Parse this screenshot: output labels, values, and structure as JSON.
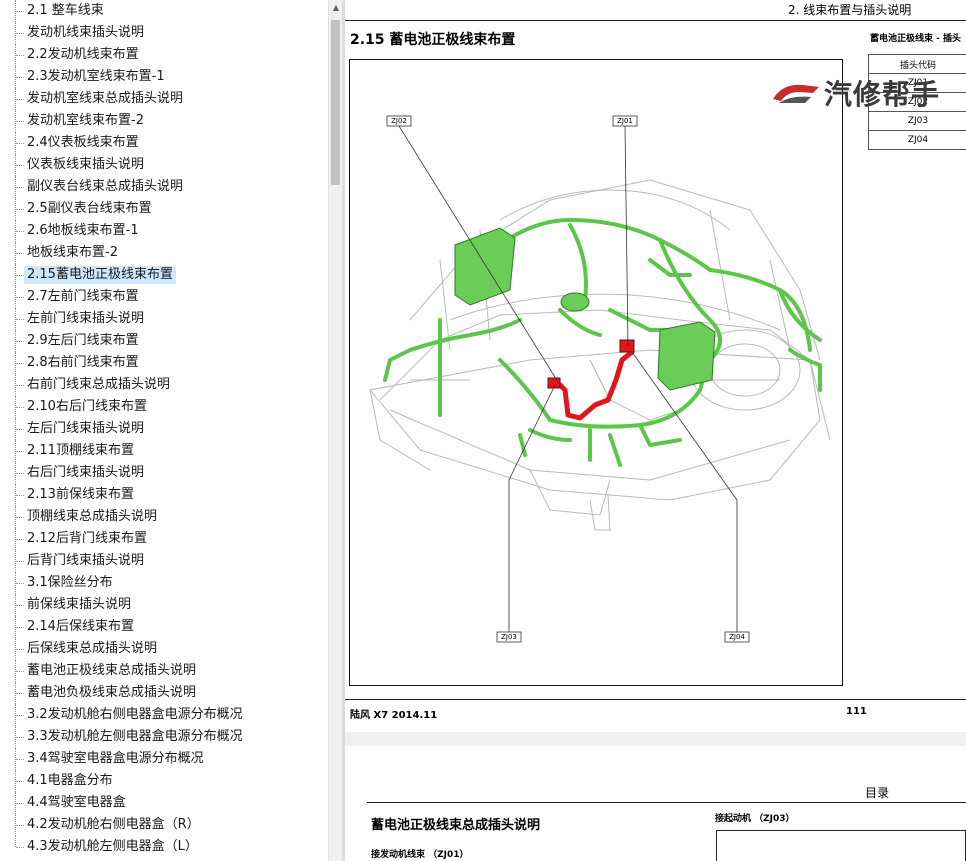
{
  "bookmarks": {
    "items": [
      "2.1 整车线束",
      "发动机线束插头说明",
      "2.2发动机线束布置",
      "2.3发动机室线束布置-1",
      "发动机室线束总成插头说明",
      "发动机室线束布置-2",
      "2.4仪表板线束布置",
      "仪表板线束插头说明",
      "副仪表台线束总成插头说明",
      "2.5副仪表台线束布置",
      "2.6地板线束布置-1",
      "地板线束布置-2",
      "2.15蓄电池正极线束布置",
      "2.7左前门线束布置",
      "左前门线束插头说明",
      "2.9左后门线束布置",
      "2.8右前门线束布置",
      "右前门线束总成插头说明",
      "2.10右后门线束布置",
      "左后门线束插头说明",
      "2.11顶棚线束布置",
      "右后门线束插头说明",
      "2.13前保线束布置",
      "顶棚线束总成插头说明",
      "2.12后背门线束布置",
      "后背门线束插头说明",
      "3.1保险丝分布",
      "前保线束插头说明",
      "2.14后保线束布置",
      "后保线束总成插头说明",
      "蓄电池正极线束总成插头说明",
      "蓄电池负极线束总成插头说明",
      "3.2发动机舱右侧电器盒电源分布概况",
      "3.3发动机舱左侧电器盒电源分布概况",
      "3.4驾驶室电器盒电源分布概况",
      "4.1电器盒分布",
      "4.4驾驶室电器盒",
      "4.2发动机舱右侧电器盒（R）",
      "4.3发动机舱左侧电器盒（L）"
    ],
    "selected_index": 12
  },
  "scrollbar": {
    "up_arrow": "▲"
  },
  "page1": {
    "header_right": "2. 线束布置与插头说明",
    "section_title": "2.15 蓄电池正极线束布置",
    "side_caption": "蓄电池正极线束 - 插头",
    "table_header": "插头代码",
    "table_rows": [
      "ZJ01",
      "ZJ02",
      "ZJ03",
      "ZJ04"
    ],
    "figure_labels": {
      "zj02": "ZJ02",
      "zj01": "ZJ01",
      "zj03": "ZJ03",
      "zj04": "ZJ04"
    },
    "footer_left": "陆风 X7 2014.11",
    "footer_right": "111"
  },
  "page2": {
    "contents_label": "目录",
    "title": "蓄电池正极线束总成插头说明",
    "subtitle": "接发动机线束 （ZJ01）",
    "right_text": "接起动机 （ZJ03）"
  },
  "watermark": {
    "text": "汽修帮手"
  },
  "colors": {
    "harness_green": "#5cc64a",
    "battery_red": "#e0161b",
    "selection": "#cde8ff"
  }
}
